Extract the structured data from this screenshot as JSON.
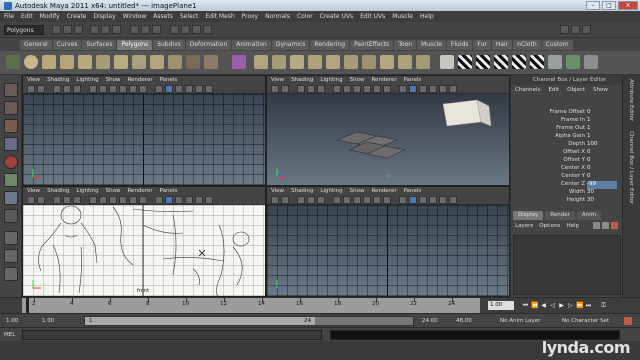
{
  "window": {
    "title": "Autodesk Maya 2011 x64: untitled*  ---  imagePlane1",
    "minimize": "–",
    "maximize": "□",
    "close": "✕"
  },
  "menubar": [
    "File",
    "Edit",
    "Modify",
    "Create",
    "Display",
    "Window",
    "Assets",
    "Select",
    "Edit Mesh",
    "Proxy",
    "Normals",
    "Color",
    "Create UVs",
    "Edit UVs",
    "Muscle",
    "Help"
  ],
  "statusline": {
    "mode": "Polygons"
  },
  "shelf": {
    "tabs": [
      "General",
      "Curves",
      "Surfaces",
      "Polygons",
      "Subdivs",
      "Deformation",
      "Animation",
      "Dynamics",
      "Rendering",
      "PaintEffects",
      "Toon",
      "Muscle",
      "Fluids",
      "Fur",
      "Hair",
      "nCloth",
      "Custom"
    ],
    "active_tab": "Polygons"
  },
  "viewport_menu": [
    "View",
    "Shading",
    "Lighting",
    "Show",
    "Renderer",
    "Panels"
  ],
  "viewports": {
    "top_left": {
      "label": ""
    },
    "top_right": {
      "label": ""
    },
    "bottom_left": {
      "label": "front"
    },
    "bottom_right": {
      "label": ""
    }
  },
  "channelbox": {
    "header": "Channel Box / Layer Editor",
    "menu": [
      "Channels",
      "Edit",
      "Object",
      "Show"
    ],
    "channels": [
      {
        "name": "Frame Offset",
        "value": "0"
      },
      {
        "name": "Frame In",
        "value": "1"
      },
      {
        "name": "Frame Out",
        "value": "1"
      },
      {
        "name": "Alpha Gain",
        "value": "1"
      },
      {
        "name": "Depth",
        "value": "100"
      },
      {
        "name": "Offset X",
        "value": "0"
      },
      {
        "name": "Offset Y",
        "value": "0"
      },
      {
        "name": "Center X",
        "value": "0"
      },
      {
        "name": "Center Y",
        "value": "0"
      },
      {
        "name": "Center Z",
        "value": "-99"
      },
      {
        "name": "Width",
        "value": "30"
      },
      {
        "name": "Height",
        "value": "30"
      }
    ],
    "selected_channel": "Center Z",
    "layer_tabs": [
      "Display",
      "Render",
      "Anim"
    ],
    "layer_menu": [
      "Layers",
      "Options",
      "Help"
    ]
  },
  "side_tabs": [
    "Attribute Editor",
    "Channel Box / Layer Editor"
  ],
  "timeslider": {
    "ticks": [
      "2",
      "4",
      "6",
      "8",
      "10",
      "12",
      "14",
      "16",
      "18",
      "20",
      "22",
      "24"
    ],
    "current_frame": "1.00"
  },
  "rangeslider": {
    "start": "1.00",
    "playback_start": "1.00",
    "range_start": "1",
    "range_end": "24",
    "playback_end": "24.00",
    "end": "48.00",
    "anim_layer": "No Anim Layer",
    "character_set": "No Character Set"
  },
  "cmdline": {
    "label": "MEL"
  },
  "watermark": {
    "text": "lynda.com"
  }
}
